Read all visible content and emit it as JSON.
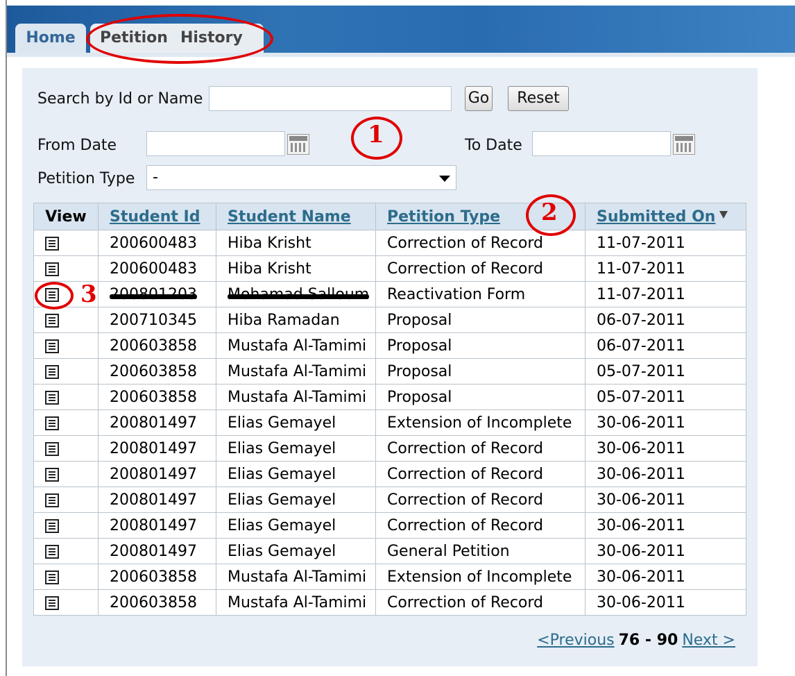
{
  "tabs": {
    "home": "Home",
    "petition": "Petition",
    "history": "History"
  },
  "search": {
    "label": "Search by Id or Name",
    "value": "",
    "go": "Go",
    "reset": "Reset"
  },
  "dates": {
    "from_label": "From Date",
    "to_label": "To Date",
    "from_value": "",
    "to_value": ""
  },
  "petition_type": {
    "label": "Petition Type",
    "selected": "-"
  },
  "annotations": [
    "1",
    "2",
    "3"
  ],
  "table": {
    "headers": {
      "view": "View",
      "student_id": "Student Id",
      "student_name": "Student Name",
      "petition_type": "Petition Type",
      "submitted_on": "Submitted On"
    },
    "rows": [
      {
        "id": "200600483",
        "name": "Hiba Krisht",
        "type": "Correction of Record",
        "date": "11-07-2011"
      },
      {
        "id": "200600483",
        "name": "Hiba Krisht",
        "type": "Correction of Record",
        "date": "11-07-2011"
      },
      {
        "id": "200801203",
        "name": "Mohamad Salloum",
        "type": "Reactivation Form",
        "date": "11-07-2011"
      },
      {
        "id": "200710345",
        "name": "Hiba Ramadan",
        "type": "Proposal",
        "date": "06-07-2011"
      },
      {
        "id": "200603858",
        "name": "Mustafa Al-Tamimi",
        "type": "Proposal",
        "date": "06-07-2011"
      },
      {
        "id": "200603858",
        "name": "Mustafa Al-Tamimi",
        "type": "Proposal",
        "date": "05-07-2011"
      },
      {
        "id": "200603858",
        "name": "Mustafa Al-Tamimi",
        "type": "Proposal",
        "date": "05-07-2011"
      },
      {
        "id": "200801497",
        "name": "Elias Gemayel",
        "type": "Extension of Incomplete",
        "date": "30-06-2011"
      },
      {
        "id": "200801497",
        "name": "Elias Gemayel",
        "type": "Correction of Record",
        "date": "30-06-2011"
      },
      {
        "id": "200801497",
        "name": "Elias Gemayel",
        "type": "Correction of Record",
        "date": "30-06-2011"
      },
      {
        "id": "200801497",
        "name": "Elias Gemayel",
        "type": "Correction of Record",
        "date": "30-06-2011"
      },
      {
        "id": "200801497",
        "name": "Elias Gemayel",
        "type": "Correction of Record",
        "date": "30-06-2011"
      },
      {
        "id": "200801497",
        "name": "Elias Gemayel",
        "type": "General Petition",
        "date": "30-06-2011"
      },
      {
        "id": "200603858",
        "name": "Mustafa Al-Tamimi",
        "type": "Extension of Incomplete",
        "date": "30-06-2011"
      },
      {
        "id": "200603858",
        "name": "Mustafa Al-Tamimi",
        "type": "Correction of Record",
        "date": "30-06-2011"
      }
    ]
  },
  "pager": {
    "previous": "<Previous",
    "range": "76 - 90",
    "next": "Next >"
  }
}
